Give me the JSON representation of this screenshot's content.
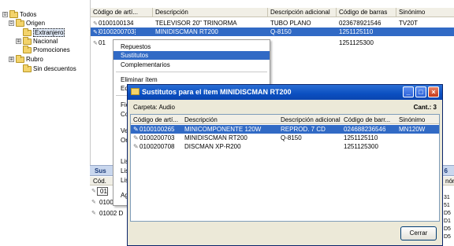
{
  "tree": {
    "nodes": [
      {
        "label": "Todos",
        "exp": "⊟"
      },
      {
        "label": "Origen",
        "exp": "⊟"
      },
      {
        "label": "Extranjero",
        "exp": ""
      },
      {
        "label": "Nacional",
        "exp": "⊞"
      },
      {
        "label": "Promociones",
        "exp": ""
      },
      {
        "label": "Rubro",
        "exp": "⊞"
      },
      {
        "label": "Sin descuentos",
        "exp": ""
      }
    ]
  },
  "grid": {
    "headers": [
      "Código de artí...",
      "Descripción",
      "Descripción adicional",
      "Código de barras",
      "Sinónimo"
    ],
    "rows": [
      [
        "0100100134",
        "TELEVISOR 20\" TRINORMA",
        "TUBO PLANO",
        "023678921546",
        "TV20T"
      ],
      [
        "0100200703",
        "MINIDISCMAN RT200",
        "Q-8150",
        "1251125110",
        ""
      ],
      [
        "01",
        "",
        "",
        "1251125300",
        ""
      ]
    ]
  },
  "context_menu": {
    "items": [
      "Repuestos",
      "Sustitutos",
      "Complementarios",
      "Eliminar ítem",
      "Ed",
      "Fic",
      "Co",
      "Ve",
      "Or",
      "Lis",
      "Lis",
      "Lis",
      "Ag"
    ]
  },
  "bottom_panel": {
    "title": "Sus",
    "count": "6",
    "col_header": "Cód.",
    "rows": [
      "01",
      "01002 M",
      "01002 D"
    ],
    "right_header": "nón",
    "right_cells": [
      "31",
      "51",
      "D5",
      "D1",
      "D5",
      "D5"
    ]
  },
  "dialog": {
    "title": "Sustitutos para el ítem MINIDISCMAN RT200",
    "carpeta": "Carpeta:  Audio",
    "cant": "Cant.: 3",
    "headers": [
      "Código de artí...",
      "Descripción",
      "Descripción adicional",
      "Código de barr...",
      "Sinónimo"
    ],
    "rows": [
      [
        "0100100265",
        "MINICOMPONENTE 120W",
        "REPROD. 7 CD",
        "024688236546",
        "MN120W"
      ],
      [
        "0100200703",
        "MINIDISCMAN RT200",
        "Q-8150",
        "1251125110",
        ""
      ],
      [
        "0100200708",
        "DISCMAN XP-R200",
        "",
        "1251125300",
        ""
      ]
    ],
    "close_label": "Cerrar",
    "min_glyph": "_",
    "max_glyph": "□",
    "close_glyph": "×"
  },
  "colors": {
    "selection": "#316ac5",
    "titlebar": "#0b4fc0",
    "folder": "#f3d36b"
  }
}
